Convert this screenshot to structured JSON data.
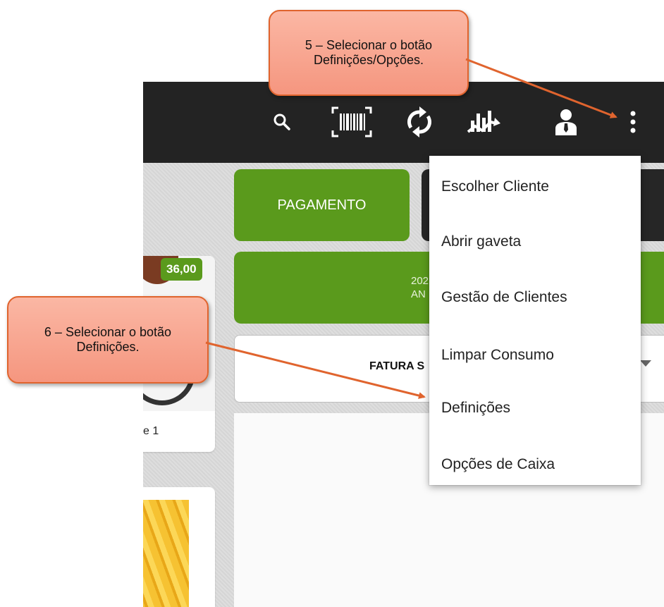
{
  "callouts": {
    "step5": {
      "line1": "5 – Selecionar o botão",
      "line2": "Definições/Opções."
    },
    "step6": {
      "line1": "6 – Selecionar o botão",
      "line2": "Definições."
    }
  },
  "toolbar": {
    "icons": [
      "search-icon",
      "barcode-icon",
      "sync-icon",
      "chart-icon",
      "user-icon",
      "more-options-icon"
    ]
  },
  "products": [
    {
      "price": "36,00",
      "name_fragment": "e 1"
    },
    {
      "image": "french-fries"
    }
  ],
  "main": {
    "payment_button": "PAGAMENTO",
    "info_fragment_1": "202",
    "info_fragment_2": "AN",
    "document_type": "FATURA S"
  },
  "menu": {
    "items": [
      "Escolher Cliente",
      "Abrir gaveta",
      "Gestão de Clientes",
      "Limpar Consumo",
      "Definições",
      "Opções de Caixa"
    ]
  },
  "colors": {
    "green": "#5a9a1c",
    "toolbar": "#232323",
    "callout": "#f5967f",
    "arrow": "#e0642e"
  }
}
